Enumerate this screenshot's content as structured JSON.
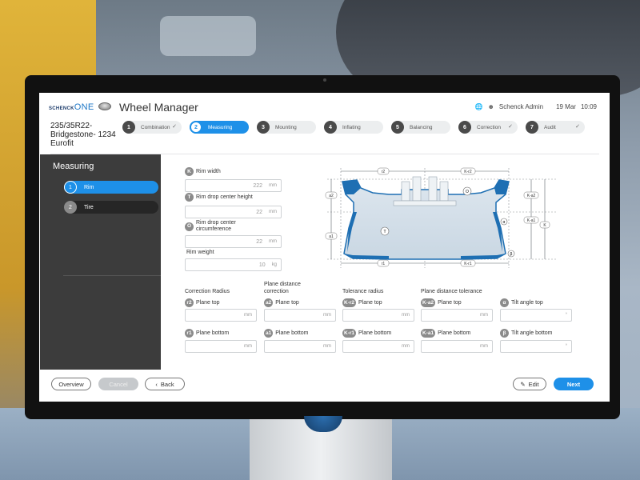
{
  "header": {
    "logo_brand": "SCHENCK",
    "logo_suffix": "ONE",
    "app_title": "Wheel Manager",
    "user": "Schenck Admin",
    "date": "19 Mar",
    "time": "10:09",
    "icons": [
      "globe-icon",
      "user-icon"
    ]
  },
  "product": {
    "name": "235/35R22-Bridgestone- 1234 Eurofit"
  },
  "steps": [
    {
      "num": "1",
      "label": "Combination",
      "done": true
    },
    {
      "num": "2",
      "label": "Measuring",
      "active": true
    },
    {
      "num": "3",
      "label": "Mounting"
    },
    {
      "num": "4",
      "label": "Inflating"
    },
    {
      "num": "5",
      "label": "Balancing"
    },
    {
      "num": "6",
      "label": "Correction",
      "done": true
    },
    {
      "num": "7",
      "label": "Audit",
      "done": true
    }
  ],
  "check_glyph": "✓",
  "sidebar": {
    "title": "Measuring",
    "items": [
      {
        "num": "1",
        "label": "Rim",
        "active": true
      },
      {
        "num": "2",
        "label": "Tire"
      }
    ]
  },
  "fields": {
    "rim_width": {
      "badge": "K",
      "label": "Rim width",
      "value": "222",
      "unit": "mm"
    },
    "rim_drop_height": {
      "badge": "T",
      "label": "Rim drop center height",
      "value": "22",
      "unit": "mm"
    },
    "rim_drop_circ": {
      "badge": "O",
      "label": "Rim drop center circumference",
      "value": "22",
      "unit": "mm"
    },
    "rim_weight": {
      "label": "Rim weight",
      "value": "10",
      "unit": "kg"
    }
  },
  "columns": [
    {
      "head": "Correction Radius",
      "top": {
        "badge": "r2",
        "label": "Plane top",
        "unit": "mm"
      },
      "bottom": {
        "badge": "r1",
        "label": "Plane bottom",
        "unit": "mm"
      }
    },
    {
      "head": "Plane distance correction",
      "top": {
        "badge": "a2",
        "label": "Plane top",
        "unit": "mm"
      },
      "bottom": {
        "badge": "a1",
        "label": "Plane bottom",
        "unit": "mm"
      }
    },
    {
      "head": "Tolerance radius",
      "top": {
        "badge": "K-r2",
        "label": "Plane top",
        "unit": "mm"
      },
      "bottom": {
        "badge": "K-r1",
        "label": "Plane bottom",
        "unit": "mm"
      }
    },
    {
      "head": "Plane distance tolerance",
      "top": {
        "badge": "K-a2",
        "label": "Plane top",
        "unit": "mm"
      },
      "bottom": {
        "badge": "K-a1",
        "label": "Plane bottom",
        "unit": "mm"
      }
    },
    {
      "head": "",
      "top": {
        "badge": "α",
        "label": "Tilt angle top",
        "unit": "°"
      },
      "bottom": {
        "badge": "β",
        "label": "Tilt angle bottom",
        "unit": "°"
      }
    }
  ],
  "diagram": {
    "labels": {
      "r2": "r2",
      "kr2": "K-r2",
      "a2": "a2",
      "ka2": "K-a2",
      "a1": "a1",
      "ka1": "K-a1",
      "k": "K",
      "r1": "r1",
      "kr1": "K-r1",
      "o": "O",
      "t": "T",
      "alpha": "α",
      "beta": "β"
    }
  },
  "footer": {
    "overview": "Overview",
    "cancel": "Cancel",
    "back": "Back",
    "edit": "Edit",
    "next": "Next"
  },
  "colors": {
    "accent": "#1e90e8",
    "sidebar": "#3c3c3c"
  }
}
